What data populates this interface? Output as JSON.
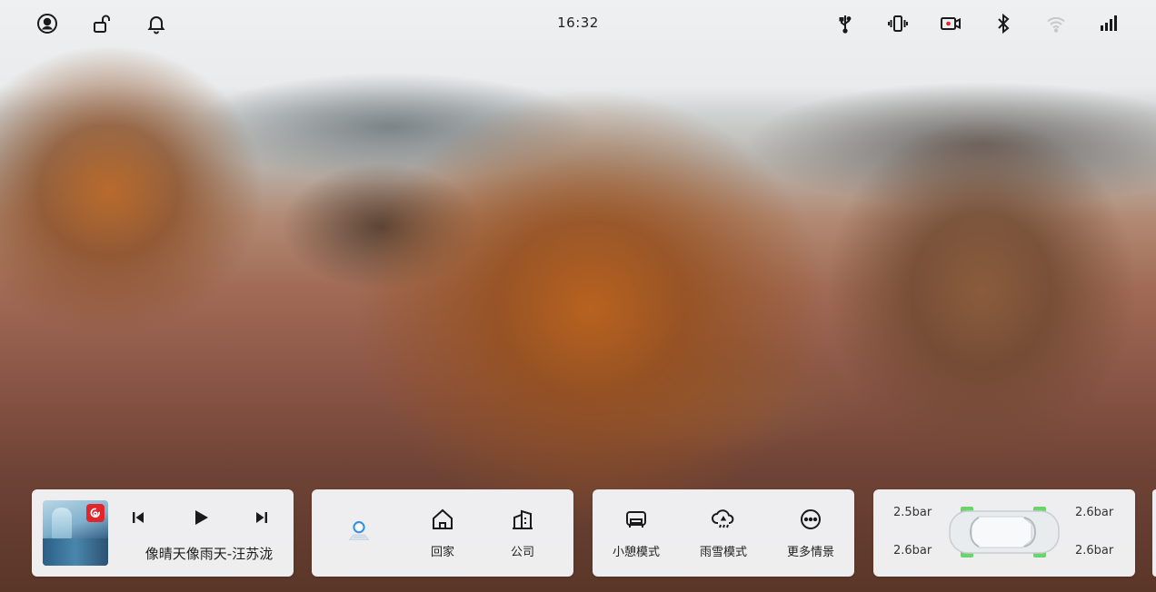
{
  "status_bar": {
    "time": "16:32",
    "left_icons": [
      "user-icon",
      "unlock-icon",
      "bell-icon"
    ],
    "right_icons": [
      "usb-icon",
      "vibrate-icon",
      "dashcam-icon",
      "bluetooth-icon",
      "wifi-icon",
      "signal-icon"
    ]
  },
  "music": {
    "song_title": "像晴天像雨天-汪苏泷",
    "controls": [
      "previous-icon",
      "play-icon",
      "next-icon"
    ],
    "app_badge_color": "#e0262b"
  },
  "navigation": {
    "search_icon": "map-search-icon",
    "home_label": "回家",
    "company_label": "公司"
  },
  "modes": {
    "nap_label": "小憩模式",
    "rain_snow_label": "雨雪模式",
    "more_label": "更多情景"
  },
  "tires": {
    "front_left": "2.5bar",
    "front_right": "2.6bar",
    "rear_left": "2.6bar",
    "rear_right": "2.6bar",
    "status_color": "#6ad46a"
  },
  "colors": {
    "accent_blue": "#2f8fe6",
    "card_bg": "#f4f6f8"
  }
}
